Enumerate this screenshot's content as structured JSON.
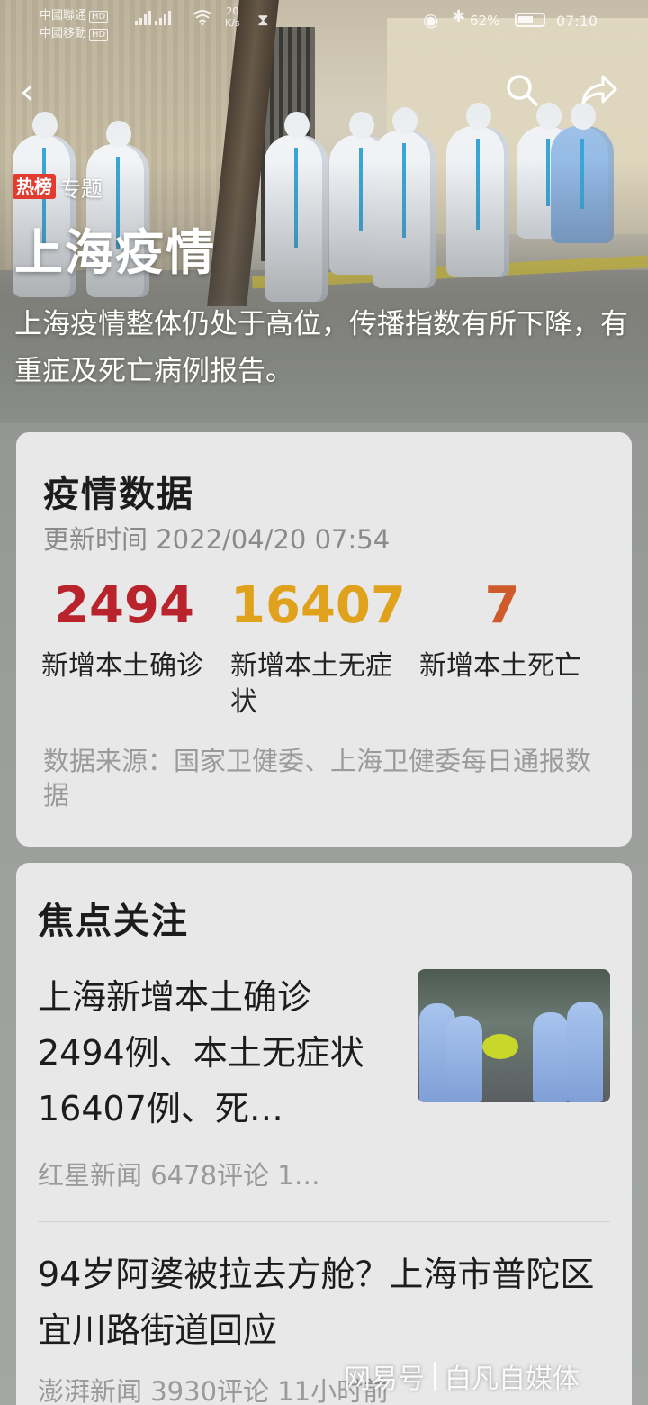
{
  "status_bar": {
    "carrier_1": "中國聯通",
    "carrier_2": "中國移動",
    "hd_tag": "HD",
    "speed_value": "20",
    "speed_unit": "K/s",
    "battery_percent": "62%",
    "battery_level": 0.62,
    "time": "07:10"
  },
  "nav": {
    "back_icon": "back-arrow-icon",
    "search_icon": "search-icon",
    "share_icon": "share-icon"
  },
  "topic": {
    "hot_badge": "热榜",
    "tag": "专题",
    "title": "上海疫情",
    "summary": "上海疫情整体仍处于高位，传播指数有所下降，有重症及死亡病例报告。"
  },
  "stats_card": {
    "title": "疫情数据",
    "update_time": "更新时间 2022/04/20 07:54",
    "items": [
      {
        "value": "2494",
        "label": "新增本土确诊",
        "color": "#b8232c"
      },
      {
        "value": "16407",
        "label": "新增本土无症状",
        "color": "#e0a21c"
      },
      {
        "value": "7",
        "label": "新增本土死亡",
        "color": "#cf5a2a"
      }
    ],
    "source": "数据来源：国家卫健委、上海卫健委每日通报数据"
  },
  "focus_card": {
    "title": "焦点关注",
    "news": [
      {
        "headline": "上海新增本土确诊2494例、本土无症状16407例、死…",
        "meta": "红星新闻  6478评论  1…",
        "has_thumbnail": true
      },
      {
        "headline": "94岁阿婆被拉去方舱？上海市普陀区宜川路街道回应",
        "meta": "澎湃新闻  3930评论  11小时前",
        "has_thumbnail": false
      }
    ]
  },
  "watermark": {
    "platform": "网易号",
    "author": "白凡自媒体"
  },
  "colors": {
    "hot_badge": "#e23b2f",
    "card_bg": "#e8e8e8",
    "page_bg": "#9a9e9b"
  }
}
